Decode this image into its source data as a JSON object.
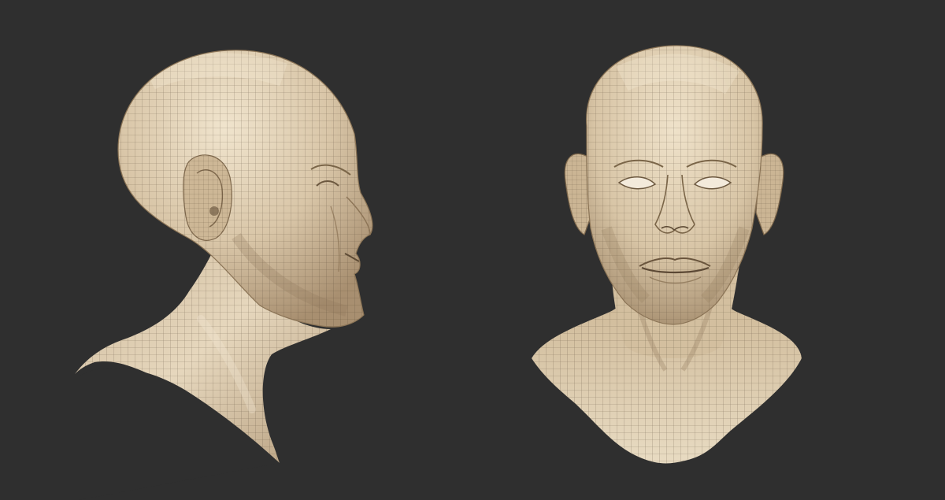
{
  "scene": {
    "background": "#2f2f2f",
    "skin_base": "#d9c6a8",
    "skin_highlight": "#efe3cc",
    "skin_shadow": "#a08a6c",
    "wire_color": "#4a3c2c",
    "views": [
      {
        "id": "profile",
        "icon": "head-profile-wireframe-icon"
      },
      {
        "id": "front",
        "icon": "head-front-wireframe-icon"
      }
    ]
  }
}
